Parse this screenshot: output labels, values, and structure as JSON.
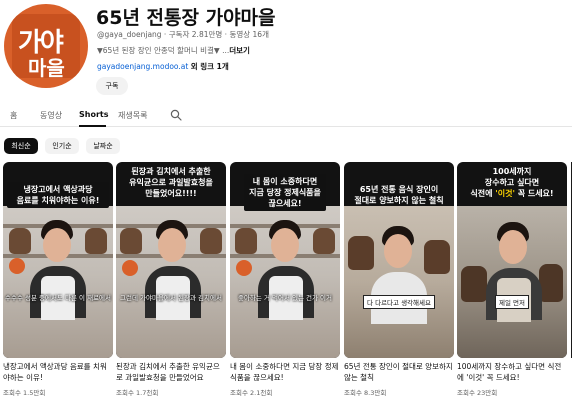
{
  "channel": {
    "avatar_line1": "가야",
    "avatar_line2": "마을",
    "title": "65년 전통장 가야마을",
    "meta": "@gaya_doenjang · 구독자 2.81만명 · 동영상 16개",
    "description": "▼65년 된장 장인 안종덕 할머니 비결▼ ...",
    "description_more": "더보기",
    "link_url": "gayadoenjang.modoo.at",
    "link_extra": "외 링크 1개",
    "subscribe_label": "구독"
  },
  "tabs": [
    {
      "label": "홈",
      "active": false
    },
    {
      "label": "동영상",
      "active": false
    },
    {
      "label": "Shorts",
      "active": true
    },
    {
      "label": "재생목록",
      "active": false
    }
  ],
  "chips": [
    {
      "label": "최신순",
      "selected": true
    },
    {
      "label": "인기순",
      "selected": false
    },
    {
      "label": "날짜순",
      "selected": false
    }
  ],
  "shorts": [
    {
      "overlay_line1": "냉장고에서 액상과당",
      "overlay_line2": "음료를 치워야하는 이유!",
      "caption": "수수수 성분 중에서도 다른 이 재료에서",
      "title": "냉장고에서 액상과당 음료를 치워야하는 이유!",
      "views": "조회수 1.5만회"
    },
    {
      "overlay_line1": "된장과 김치에서 추출한",
      "overlay_line2": "유익균으로 과일발효청을",
      "overlay_line3": "만들었어요!!!!",
      "caption": "그런데 가야마을에서 된장과 김치에서",
      "title": "된장과 김치에서 추출한 유익균으로 과일발효청을 만들었어요",
      "views": "조회수 1.7천회"
    },
    {
      "overlay_line1": "내 몸이 소중하다면",
      "overlay_line2": "지금 당장 정제식품을",
      "overlay_line3": "끊으세요!",
      "caption": "좋아하는 거 먹어서 있는 건가 이거",
      "title": "내 몸이 소중하다면 지금 당장 정제식품을 끊으세요!",
      "views": "조회수 2.1천회"
    },
    {
      "overlay_line1": "65년 전통 음식 장인이",
      "overlay_line2": "절대로 양보하지 않는 철칙",
      "caption": "다 다르다고 생각해세요",
      "title": "65년 전통 장인이 절대로 양보하지 않는 철칙",
      "views": "조회수 8.3만회"
    },
    {
      "overlay_line1": "100세까지",
      "overlay_line2": "장수하고 싶다면",
      "overlay_line3_pre": "식전에 ",
      "overlay_line3_hl": "'이것'",
      "overlay_line3_post": " 꼭 드세요!",
      "caption": "제일 먼저",
      "title": "100세까지 장수하고 싶다면 식전에 '이것' 꼭 드세요!",
      "views": "조회수 23만회"
    }
  ],
  "colors": {
    "brand_orange": "#d9602a",
    "link_blue": "#065fd4",
    "highlight_yellow": "#ffd400"
  },
  "icons": {
    "search": "search-icon",
    "more": "more-vert-icon"
  }
}
